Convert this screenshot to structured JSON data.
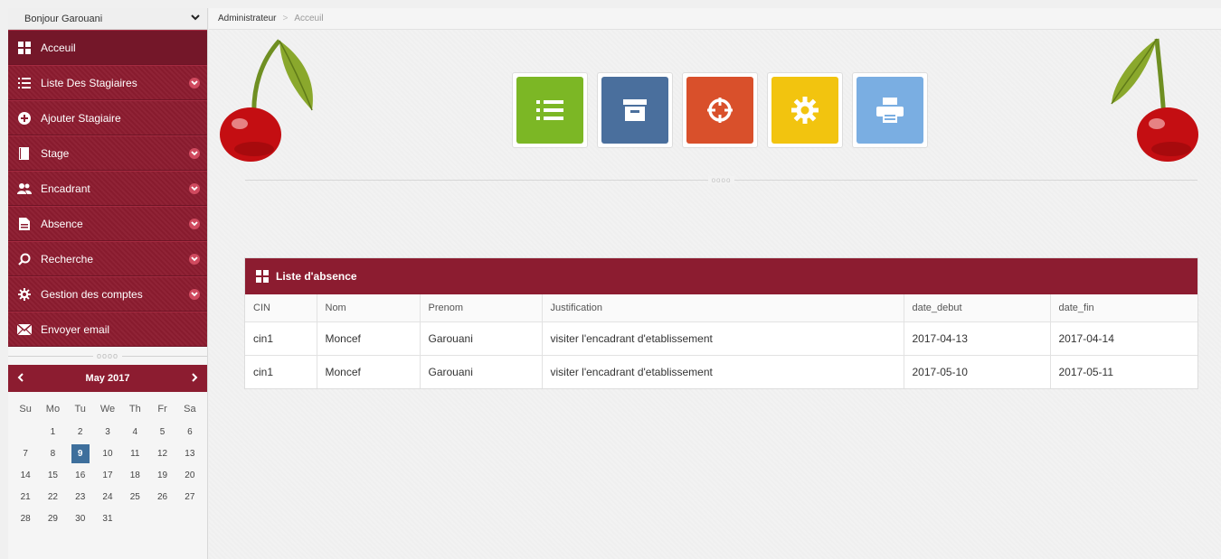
{
  "user_bar": {
    "greeting": "Bonjour Garouani"
  },
  "menu": [
    {
      "label": "Acceuil",
      "icon": "grid-icon",
      "has_arrow": false
    },
    {
      "label": "Liste Des Stagiaires",
      "icon": "list-icon",
      "has_arrow": true
    },
    {
      "label": "Ajouter Stagiaire",
      "icon": "plus-circle-icon",
      "has_arrow": false
    },
    {
      "label": "Stage",
      "icon": "book-icon",
      "has_arrow": true
    },
    {
      "label": "Encadrant",
      "icon": "users-icon",
      "has_arrow": true
    },
    {
      "label": "Absence",
      "icon": "file-icon",
      "has_arrow": true
    },
    {
      "label": "Recherche",
      "icon": "search-icon",
      "has_arrow": true
    },
    {
      "label": "Gestion des comptes",
      "icon": "gear-icon",
      "has_arrow": true
    },
    {
      "label": "Envoyer email",
      "icon": "envelope-icon",
      "has_arrow": false
    }
  ],
  "divider_dots": "oooo",
  "calendar": {
    "title": "May 2017",
    "weekdays": [
      "Su",
      "Mo",
      "Tu",
      "We",
      "Th",
      "Fr",
      "Sa"
    ],
    "days": [
      "",
      "1",
      "2",
      "3",
      "4",
      "5",
      "6",
      "7",
      "8",
      "9",
      "10",
      "11",
      "12",
      "13",
      "14",
      "15",
      "16",
      "17",
      "18",
      "19",
      "20",
      "21",
      "22",
      "23",
      "24",
      "25",
      "26",
      "27",
      "28",
      "29",
      "30",
      "31"
    ],
    "today": "9"
  },
  "breadcrumb": {
    "root": "Administrateur",
    "separator": ">",
    "current": "Acceuil"
  },
  "shortcuts": [
    {
      "icon": "list-icon",
      "color": "#7cb725"
    },
    {
      "icon": "archive-icon",
      "color": "#4a6f9d"
    },
    {
      "icon": "crosshair-icon",
      "color": "#d9502b"
    },
    {
      "icon": "gear-icon",
      "color": "#f2c40f"
    },
    {
      "icon": "printer-icon",
      "color": "#7aaee2"
    }
  ],
  "colors": {
    "brand": "#8c1c30",
    "today": "#3e6f9c"
  },
  "absence_panel": {
    "title": "Liste d'absence",
    "columns": [
      "CIN",
      "Nom",
      "Prenom",
      "Justification",
      "date_debut",
      "date_fin"
    ],
    "rows": [
      [
        "cin1",
        "Moncef",
        "Garouani",
        "visiter l'encadrant d'etablissement",
        "2017-04-13",
        "2017-04-14"
      ],
      [
        "cin1",
        "Moncef",
        "Garouani",
        "visiter l'encadrant d'etablissement",
        "2017-05-10",
        "2017-05-11"
      ]
    ]
  }
}
